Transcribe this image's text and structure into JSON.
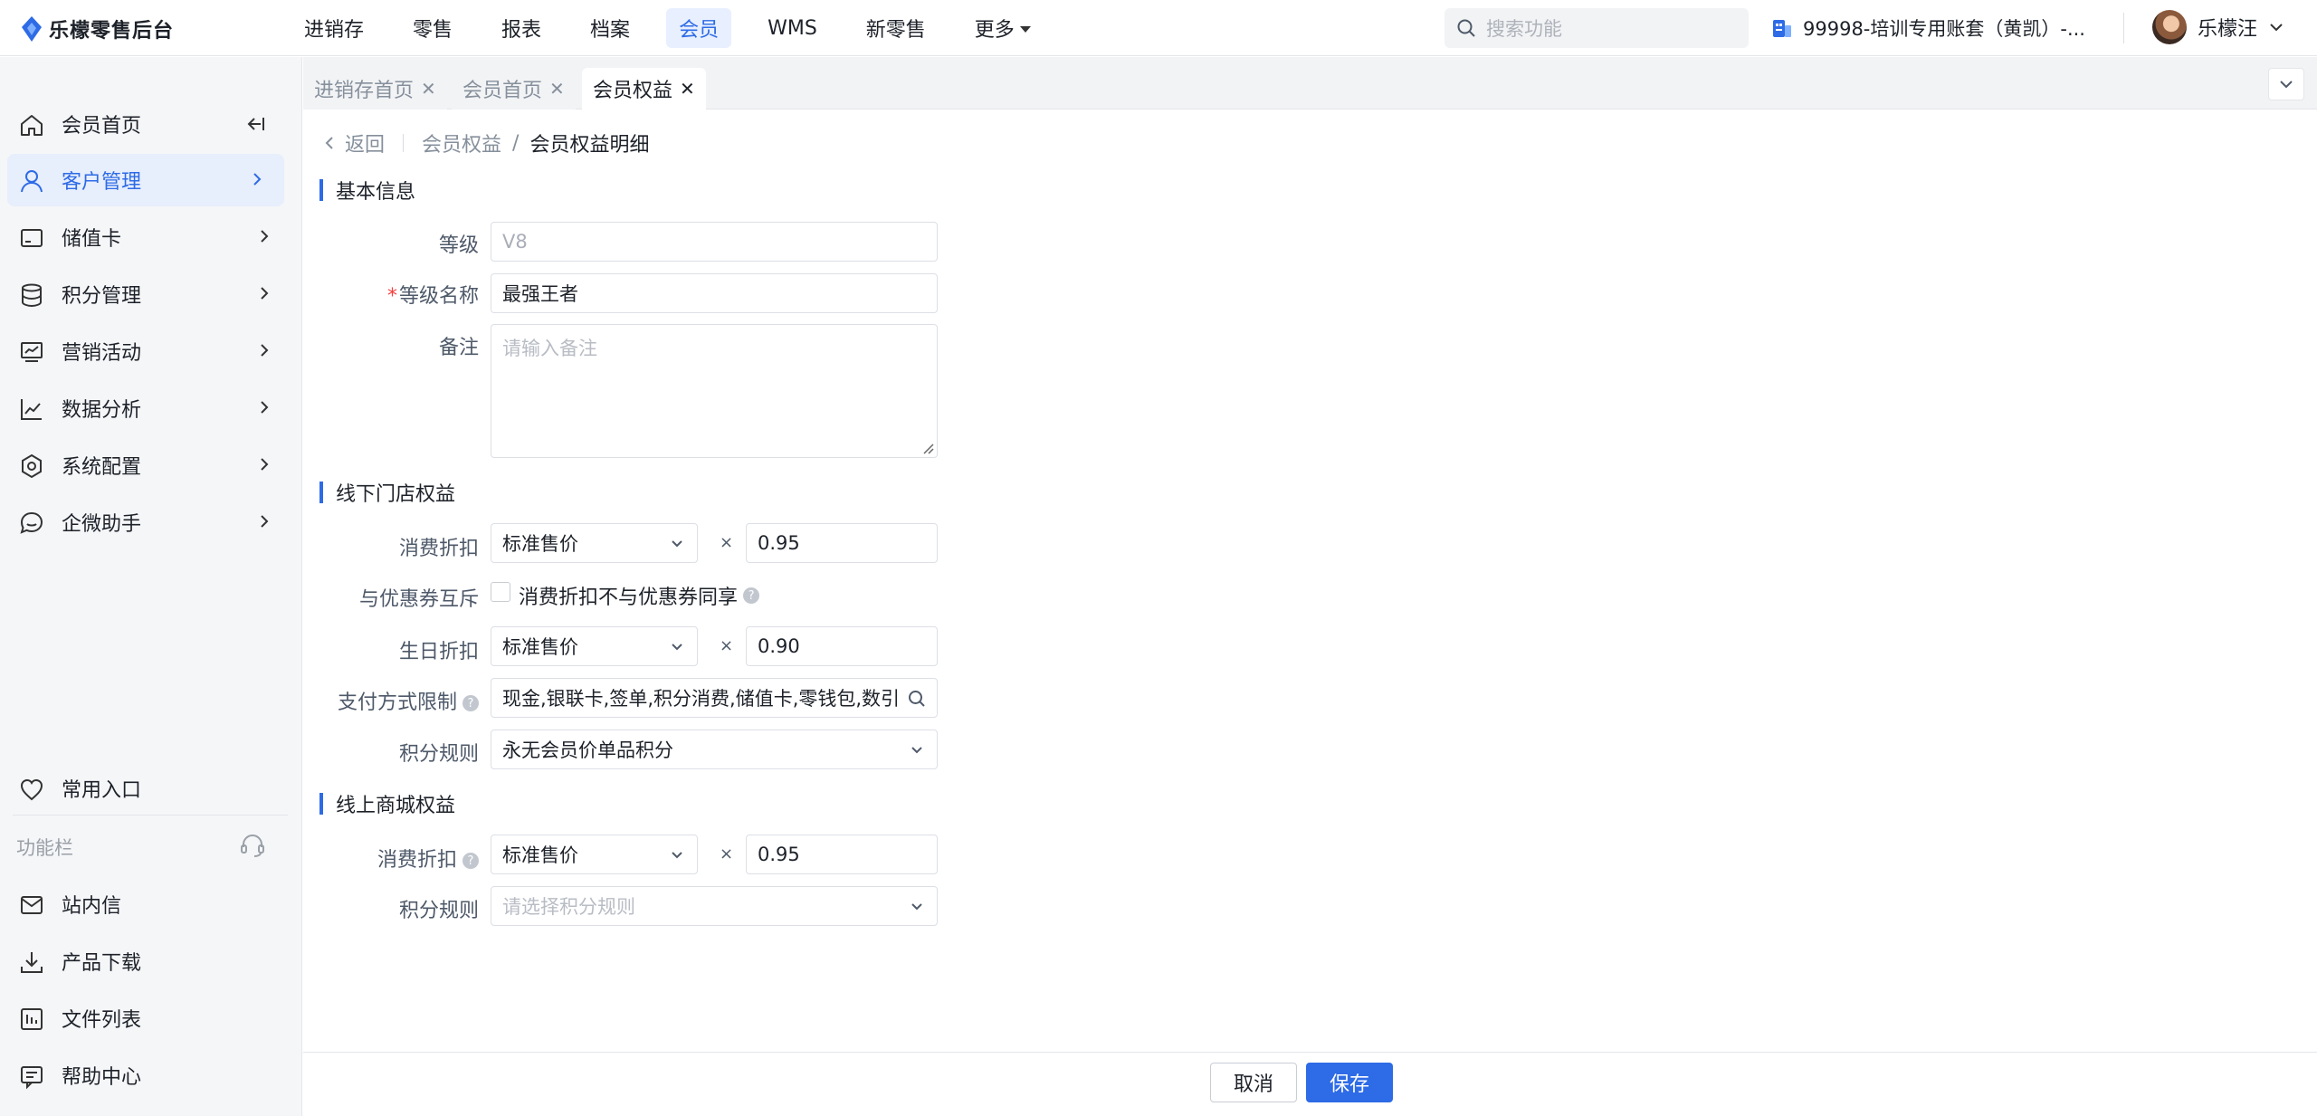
{
  "brand": {
    "name": "乐檬零售后台"
  },
  "topnav": {
    "items": [
      {
        "label": "进销存"
      },
      {
        "label": "零售"
      },
      {
        "label": "报表"
      },
      {
        "label": "档案"
      },
      {
        "label": "会员"
      },
      {
        "label": "WMS"
      },
      {
        "label": "新零售"
      },
      {
        "label": "更多"
      }
    ],
    "active": "会员",
    "search_placeholder": "搜索功能",
    "account": "99998-培训专用账套（黄凯）-...",
    "user": "乐檬汪"
  },
  "sidebar": {
    "items": [
      {
        "label": "会员首页",
        "icon": "home-icon"
      },
      {
        "label": "客户管理",
        "icon": "user-icon"
      },
      {
        "label": "储值卡",
        "icon": "card-icon"
      },
      {
        "label": "积分管理",
        "icon": "database-icon"
      },
      {
        "label": "营销活动",
        "icon": "chart-board-icon"
      },
      {
        "label": "数据分析",
        "icon": "line-chart-icon"
      },
      {
        "label": "系统配置",
        "icon": "gear-icon"
      },
      {
        "label": "企微助手",
        "icon": "chat-icon"
      }
    ],
    "active": "客户管理",
    "favorites": "常用入口",
    "func_label": "功能栏",
    "bottom_items": [
      {
        "label": "站内信",
        "icon": "mail-icon"
      },
      {
        "label": "产品下载",
        "icon": "download-icon"
      },
      {
        "label": "文件列表",
        "icon": "file-list-icon"
      },
      {
        "label": "帮助中心",
        "icon": "help-icon"
      }
    ]
  },
  "tabs": [
    {
      "label": "进销存首页"
    },
    {
      "label": "会员首页"
    },
    {
      "label": "会员权益"
    }
  ],
  "active_tab": "会员权益",
  "breadcrumb": {
    "back": "返回",
    "parent": "会员权益",
    "sep": "/",
    "current": "会员权益明细"
  },
  "basic": {
    "title": "基本信息",
    "level_label": "等级",
    "level_value": "V8",
    "name_label": "等级名称",
    "name_value": "最强王者",
    "required_mark": "*",
    "remark_label": "备注",
    "remark_placeholder": "请输入备注"
  },
  "offline": {
    "title": "线下门店权益",
    "discount_label": "消费折扣",
    "discount_price": "标准售价",
    "discount_value": "0.95",
    "exclusive_label": "与优惠券互斥",
    "exclusive_text": "消费折扣不与优惠券同享",
    "exclusive_checked": false,
    "birthday_label": "生日折扣",
    "birthday_price": "标准售价",
    "birthday_value": "0.90",
    "payment_label": "支付方式限制",
    "payment_value": "现金,银联卡,签单,积分消费,储值卡,零钱包,数引",
    "points_label": "积分规则",
    "points_value": "永无会员价单品积分"
  },
  "online": {
    "title": "线上商城权益",
    "discount_label": "消费折扣",
    "discount_price": "标准售价",
    "discount_value": "0.95",
    "points_label": "积分规则",
    "points_placeholder": "请选择积分规则"
  },
  "multiply": "×",
  "help_mark": "?",
  "footer": {
    "cancel": "取消",
    "save": "保存"
  },
  "theme": {
    "primary": "#2e6be6",
    "active_bg": "#e7eefc",
    "danger": "#f53f3f"
  }
}
